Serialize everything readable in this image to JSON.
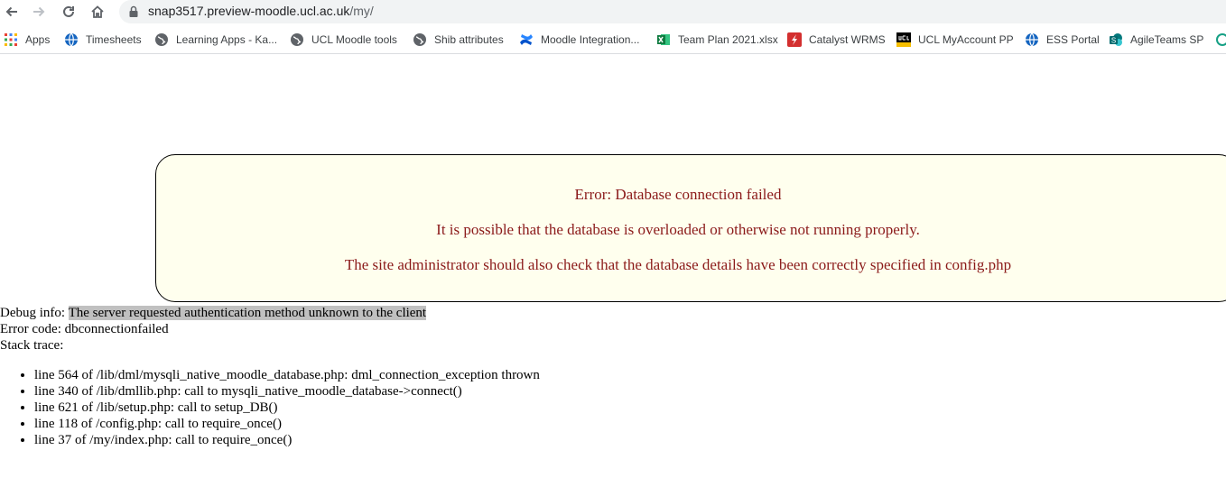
{
  "browser": {
    "url_host": "snap3517.preview-moodle.ucl.ac.uk",
    "url_path": "/my/",
    "bookmarks": [
      {
        "label": "Apps",
        "icon": "apps-grid-icon"
      },
      {
        "label": "Timesheets",
        "icon": "globe-blue-icon"
      },
      {
        "label": "Learning Apps - Ka...",
        "icon": "globe-icon"
      },
      {
        "label": "UCL Moodle tools",
        "icon": "globe-icon"
      },
      {
        "label": "Shib attributes",
        "icon": "globe-icon"
      },
      {
        "label": "Moodle Integration...",
        "icon": "confluence-icon"
      },
      {
        "label": "Team Plan 2021.xlsx",
        "icon": "excel-icon"
      },
      {
        "label": "Catalyst WRMS",
        "icon": "wrms-icon"
      },
      {
        "label": "UCL MyAccount PP",
        "icon": "ucl-icon"
      },
      {
        "label": "ESS Portal",
        "icon": "globe-blue-icon"
      },
      {
        "label": "AgileTeams SP",
        "icon": "sharepoint-icon"
      }
    ]
  },
  "error": {
    "title": "Error: Database connection failed",
    "message": "It is possible that the database is overloaded or otherwise not running properly.",
    "admin_note": "The site administrator should also check that the database details have been correctly specified in config.php"
  },
  "debug": {
    "info_label": "Debug info: ",
    "info_value": "The server requested authentication method unknown to the client",
    "error_code_label": "Error code: ",
    "error_code_value": "dbconnectionfailed",
    "stack_label": "Stack trace:",
    "stack": [
      "line 564 of /lib/dml/mysqli_native_moodle_database.php: dml_connection_exception thrown",
      "line 340 of /lib/dmllib.php: call to mysqli_native_moodle_database->connect()",
      "line 621 of /lib/setup.php: call to setup_DB()",
      "line 118 of /config.php: call to require_once()",
      "line 37 of /my/index.php: call to require_once()"
    ]
  }
}
